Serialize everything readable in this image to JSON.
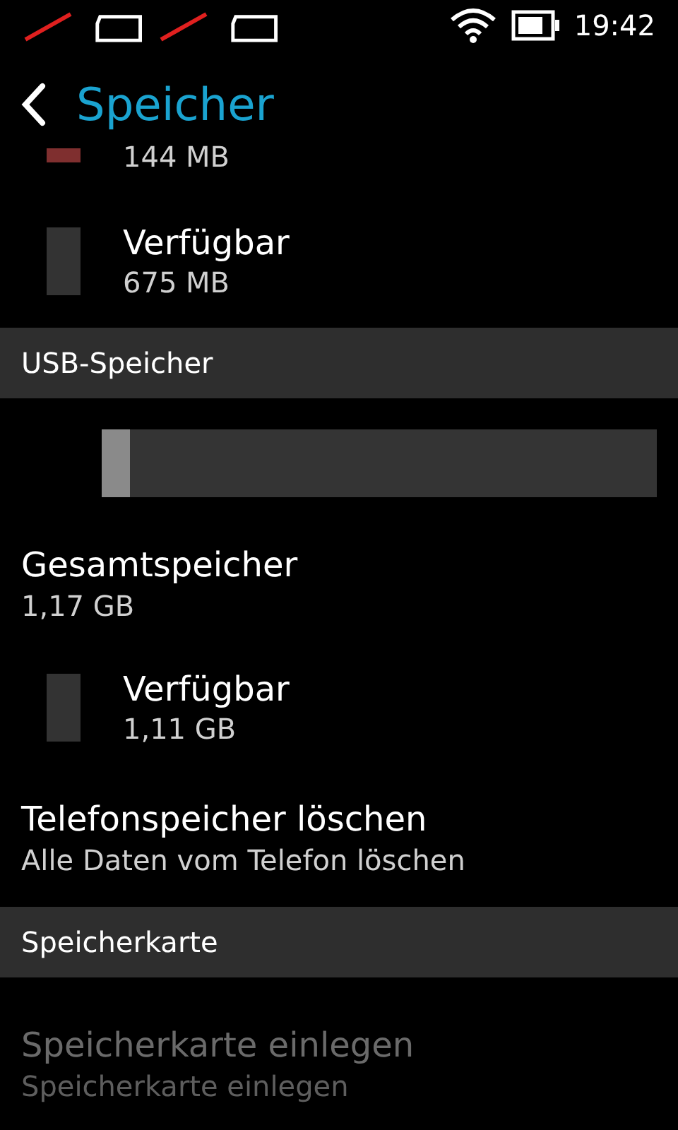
{
  "status_bar": {
    "time": "19:42"
  },
  "header": {
    "title": "Speicher"
  },
  "blocks": [
    {
      "kind": "legend",
      "value": "144 MB",
      "color": "#7f2f2f"
    },
    {
      "kind": "legend",
      "label": "Verfügbar",
      "value": "675 MB",
      "color": "#333333"
    },
    {
      "kind": "section",
      "title": "USB-Speicher"
    },
    {
      "kind": "bar",
      "level": 0.05
    },
    {
      "kind": "item",
      "label": "Gesamtspeicher",
      "value": "1,17 GB",
      "disabled": false
    },
    {
      "kind": "legend",
      "label": "Verfügbar",
      "value": "1,11 GB",
      "color": "#333333"
    },
    {
      "kind": "item",
      "label": "Telefonspeicher löschen",
      "value": "Alle Daten vom Telefon löschen",
      "disabled": false
    },
    {
      "kind": "section",
      "title": "Speicherkarte"
    },
    {
      "kind": "item",
      "label": "Speicherkarte einlegen",
      "value": "Speicherkarte einlegen",
      "disabled": true
    }
  ]
}
